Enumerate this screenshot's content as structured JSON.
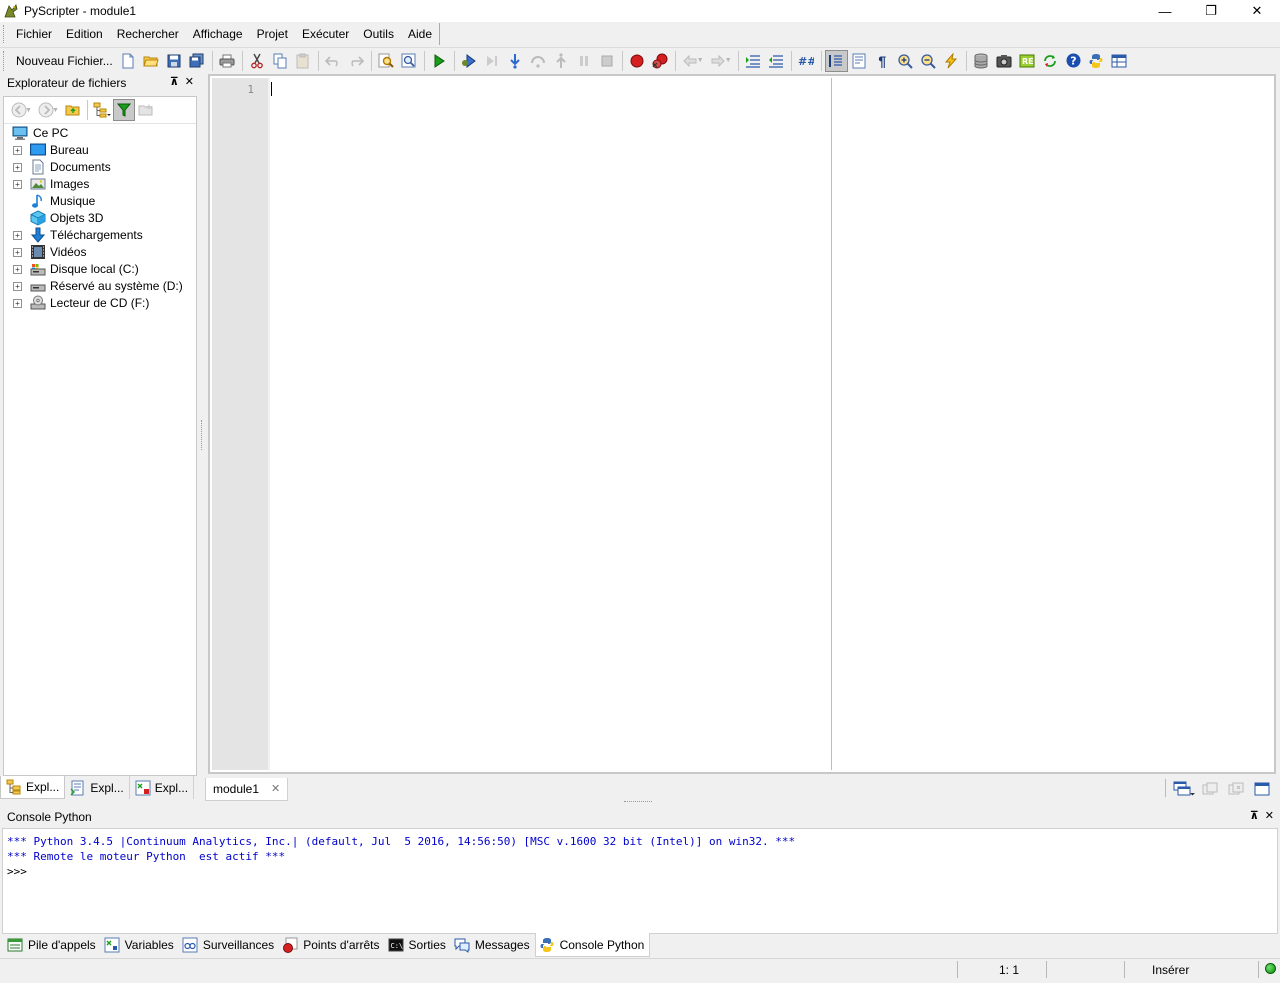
{
  "window": {
    "title": "PyScripter - module1",
    "controls": {
      "minimize": "—",
      "restore": "❐",
      "close": "✕"
    }
  },
  "menu": [
    "Fichier",
    "Edition",
    "Rechercher",
    "Affichage",
    "Projet",
    "Exécuter",
    "Outils",
    "Aide"
  ],
  "toolbar": {
    "new_file_label": "Nouveau Fichier..."
  },
  "file_explorer": {
    "title": "Explorateur de fichiers",
    "pin": "⊼",
    "close": "✕",
    "root": "Ce PC",
    "items": [
      {
        "label": "Bureau",
        "expandable": true,
        "icon": "desktop-icon"
      },
      {
        "label": "Documents",
        "expandable": true,
        "icon": "documents-icon"
      },
      {
        "label": "Images",
        "expandable": true,
        "icon": "images-icon"
      },
      {
        "label": "Musique",
        "expandable": false,
        "icon": "music-icon"
      },
      {
        "label": "Objets 3D",
        "expandable": false,
        "icon": "objects-3d-icon"
      },
      {
        "label": "Téléchargements",
        "expandable": true,
        "icon": "downloads-icon"
      },
      {
        "label": "Vidéos",
        "expandable": true,
        "icon": "videos-icon"
      },
      {
        "label": "Disque local (C:)",
        "expandable": true,
        "icon": "local-disk-icon"
      },
      {
        "label": "Réservé au système (D:)",
        "expandable": true,
        "icon": "system-drive-icon"
      },
      {
        "label": "Lecteur de CD (F:)",
        "expandable": true,
        "icon": "cd-drive-icon"
      }
    ],
    "tabs": [
      "Expl...",
      "Expl...",
      "Expl..."
    ]
  },
  "editor": {
    "line_numbers": [
      "1"
    ],
    "tabs": [
      {
        "label": "module1",
        "close": "✕"
      }
    ]
  },
  "console": {
    "title": "Console Python",
    "lines": [
      "*** Python 3.4.5 |Continuum Analytics, Inc.| (default, Jul  5 2016, 14:56:50) [MSC v.1600 32 bit (Intel)] on win32. ***",
      "*** Remote le moteur Python  est actif ***"
    ],
    "prompt": ">>>"
  },
  "bottom_tabs": [
    {
      "label": "Pile d'appels",
      "icon": "call-stack-icon"
    },
    {
      "label": "Variables",
      "icon": "variables-icon"
    },
    {
      "label": "Surveillances",
      "icon": "watches-icon"
    },
    {
      "label": "Points d'arrêts",
      "icon": "breakpoints-icon"
    },
    {
      "label": "Sorties",
      "icon": "output-icon"
    },
    {
      "label": "Messages",
      "icon": "messages-icon"
    },
    {
      "label": "Console Python",
      "icon": "python-console-icon",
      "active": true
    }
  ],
  "status": {
    "position": "1: 1",
    "mode": "Insérer"
  }
}
